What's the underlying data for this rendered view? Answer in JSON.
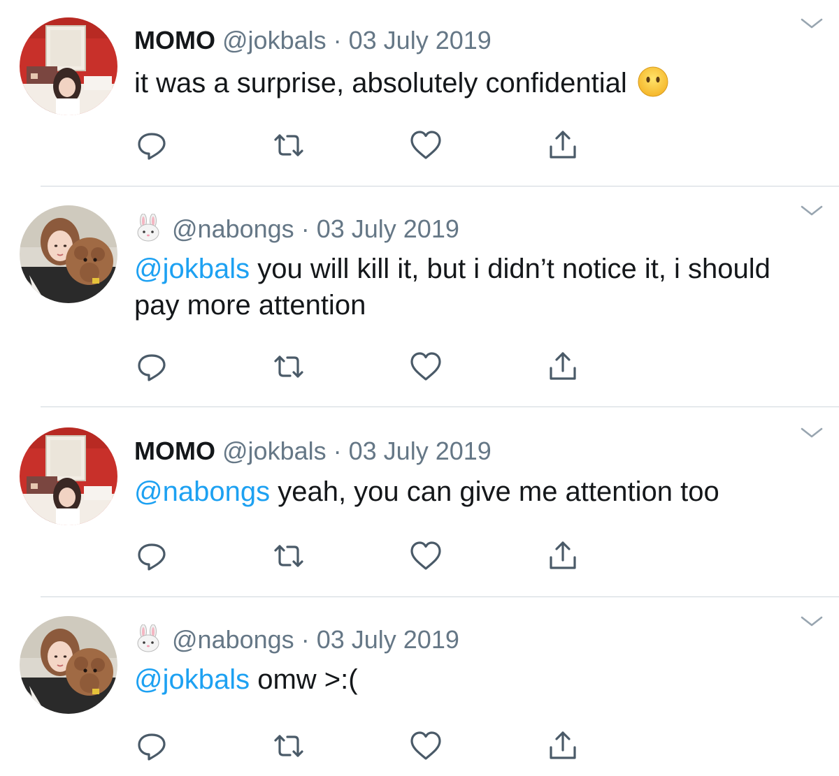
{
  "tweets": [
    {
      "name": "MOMO",
      "name_emoji": "",
      "handle": "@jokbals",
      "separator": "·",
      "date": "03 July 2019",
      "mention": "",
      "text": "it was a surprise, absolutely confidential",
      "text_emoji": "face-without-mouth-emoji",
      "avatar": "momo-avatar"
    },
    {
      "name": "",
      "name_emoji": "rabbit-face-emoji",
      "handle": "@nabongs",
      "separator": "·",
      "date": "03 July 2019",
      "mention": "@jokbals",
      "text": " you will kill it, but i didn’t notice it, i should pay more attention",
      "text_emoji": "",
      "avatar": "nabongs-avatar"
    },
    {
      "name": "MOMO",
      "name_emoji": "",
      "handle": "@jokbals",
      "separator": "·",
      "date": "03 July 2019",
      "mention": "@nabongs",
      "text": " yeah, you can give me attention too",
      "text_emoji": "",
      "avatar": "momo-avatar"
    },
    {
      "name": "",
      "name_emoji": "rabbit-face-emoji",
      "handle": "@nabongs",
      "separator": "·",
      "date": "03 July 2019",
      "mention": "@jokbals",
      "text": " omw >:(",
      "text_emoji": "",
      "avatar": "nabongs-avatar"
    }
  ],
  "actions": [
    "reply-icon",
    "retweet-icon",
    "like-icon",
    "share-icon"
  ],
  "colors": {
    "text": "#14171a",
    "secondary": "#657786",
    "link": "#1da1f2",
    "divider": "#cfd6dc"
  }
}
